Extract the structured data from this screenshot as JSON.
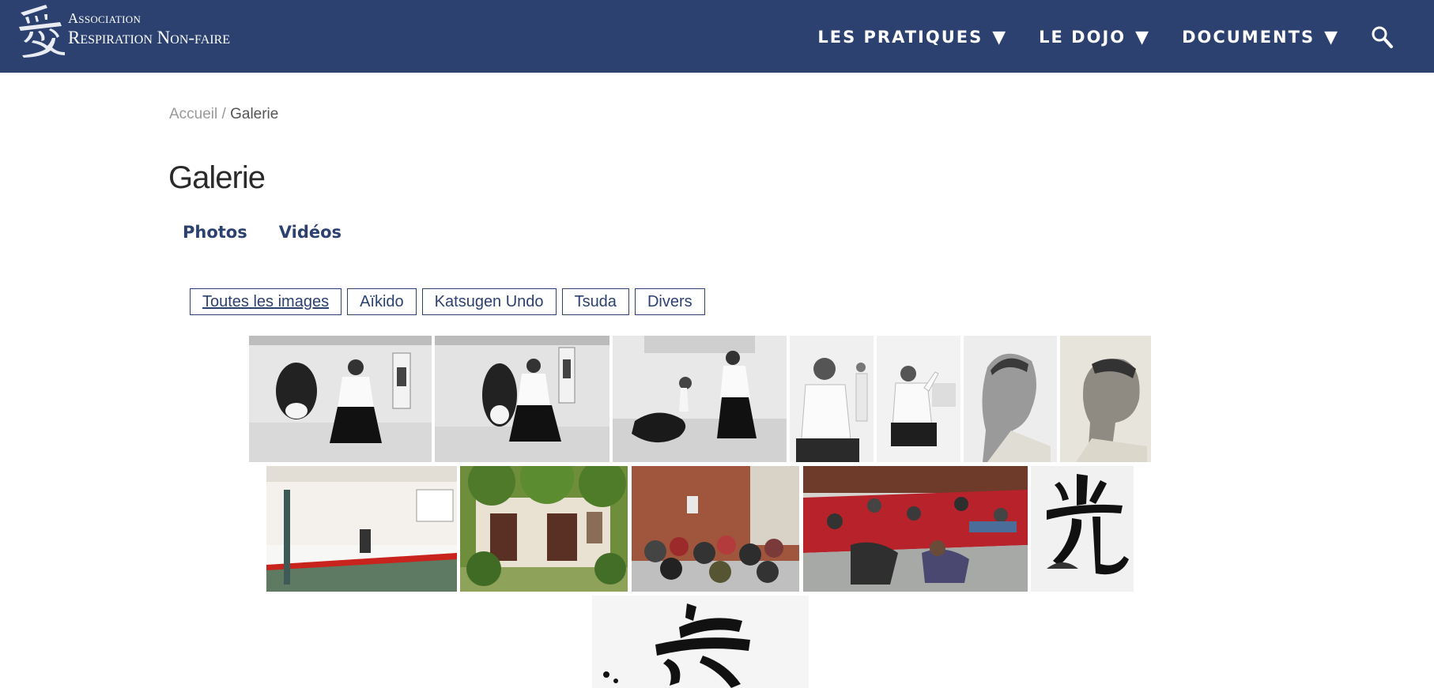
{
  "header": {
    "logo_line1": "Association",
    "logo_line2": "Respiration Non-faire",
    "nav": [
      {
        "label": "LES PRATIQUES",
        "caret": "▼"
      },
      {
        "label": "LE DOJO",
        "caret": "▼"
      },
      {
        "label": "DOCUMENTS",
        "caret": "▼"
      }
    ]
  },
  "breadcrumb": {
    "home": "Accueil",
    "separator": " / ",
    "current": "Galerie"
  },
  "page": {
    "title": "Galerie"
  },
  "tabs": [
    "Photos",
    "Vidéos"
  ],
  "filters": [
    "Toutes les images",
    "Aïkido",
    "Katsugen Undo",
    "Tsuda",
    "Divers"
  ],
  "gallery": {
    "items": [
      {
        "subject": "aikido throw, black and white"
      },
      {
        "subject": "aikido throw, black and white"
      },
      {
        "subject": "aikido throw, black and white"
      },
      {
        "subject": "seated master in white gi"
      },
      {
        "subject": "seated master in seiza"
      },
      {
        "subject": "portrait profile"
      },
      {
        "subject": "portrait profile"
      },
      {
        "subject": "dojo interior"
      },
      {
        "subject": "dojo entrance with garden"
      },
      {
        "subject": "group practice seated"
      },
      {
        "subject": "group practice on mats"
      },
      {
        "subject": "calligraphy"
      },
      {
        "subject": "calligraphy"
      }
    ]
  },
  "colors": {
    "header_bg": "#2c4170",
    "accent": "#2c4170"
  }
}
